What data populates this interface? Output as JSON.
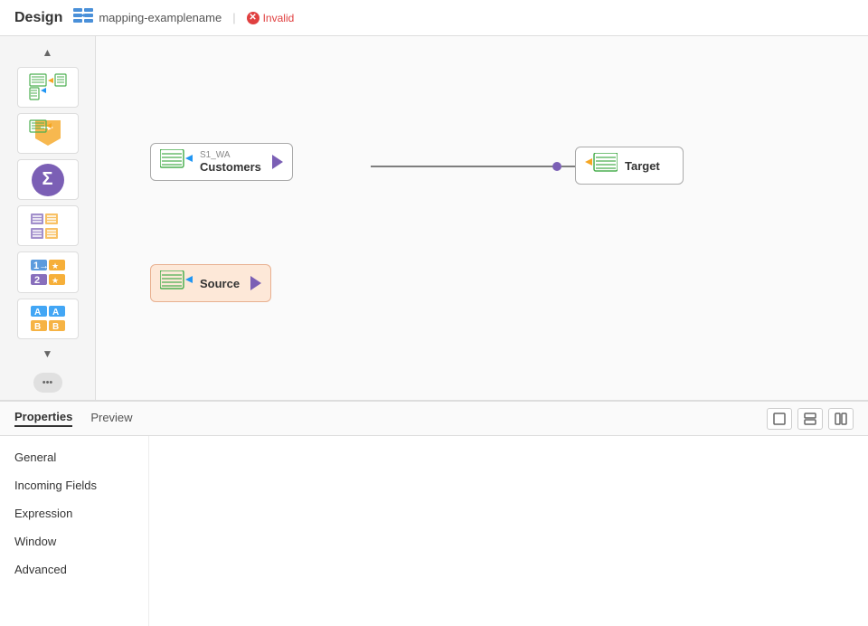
{
  "header": {
    "title": "Design",
    "mapping_name": "mapping-examplename",
    "status": "Invalid"
  },
  "toolbar": {
    "scroll_up": "▲",
    "scroll_down": "▼",
    "more_dots": "•••",
    "buttons": [
      {
        "id": "source-target",
        "label": "source-target-icon"
      },
      {
        "id": "transform",
        "label": "transform-icon"
      },
      {
        "id": "aggregate",
        "label": "aggregate-icon"
      },
      {
        "id": "filter",
        "label": "filter-icon"
      },
      {
        "id": "expression",
        "label": "expression-icon"
      },
      {
        "id": "rename",
        "label": "rename-icon"
      }
    ]
  },
  "canvas": {
    "nodes": [
      {
        "id": "customers",
        "sublabel": "S1_WA",
        "name": "Customers",
        "type": "source"
      },
      {
        "id": "target",
        "name": "Target",
        "type": "target"
      },
      {
        "id": "source",
        "name": "Source",
        "type": "source-unconnected"
      }
    ]
  },
  "bottom_panel": {
    "tabs": [
      {
        "id": "properties",
        "label": "Properties",
        "active": true
      },
      {
        "id": "preview",
        "label": "Preview",
        "active": false
      }
    ],
    "view_buttons": [
      "⬜",
      "⬛",
      "▤"
    ],
    "sidebar_items": [
      {
        "id": "general",
        "label": "General"
      },
      {
        "id": "incoming-fields",
        "label": "Incoming Fields"
      },
      {
        "id": "expression",
        "label": "Expression"
      },
      {
        "id": "window",
        "label": "Window"
      },
      {
        "id": "advanced",
        "label": "Advanced"
      }
    ]
  }
}
